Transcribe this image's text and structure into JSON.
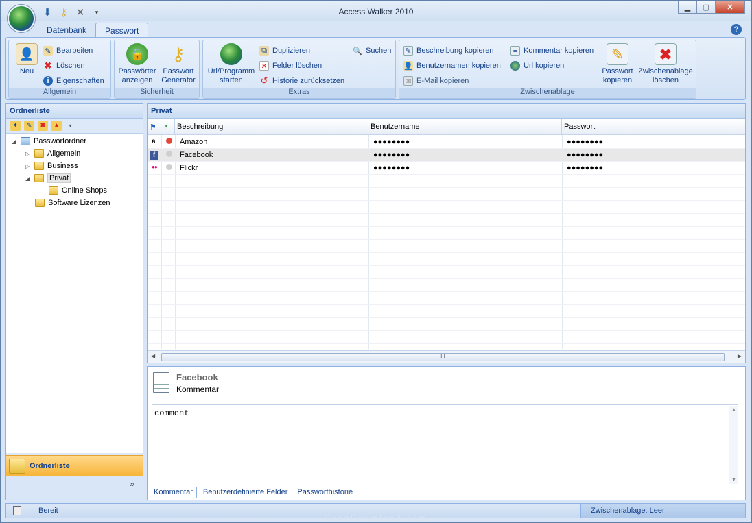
{
  "window": {
    "title": "Access Walker 2010"
  },
  "ribbon_tabs": [
    {
      "label": "Datenbank"
    },
    {
      "label": "Passwort"
    }
  ],
  "ribbon": {
    "allgemein": {
      "label": "Allgemein",
      "neu": "Neu",
      "bearbeiten": "Bearbeiten",
      "loeschen": "Löschen",
      "eigenschaften": "Eigenschaften"
    },
    "sicherheit": {
      "label": "Sicherheit",
      "anzeigen": [
        "Passwörter",
        "anzeigen"
      ],
      "generator": [
        "Passwort",
        "Generator"
      ]
    },
    "extras": {
      "label": "Extras",
      "url": [
        "Url/Programm",
        "starten"
      ],
      "duplizieren": "Duplizieren",
      "felder": "Felder löschen",
      "historie": "Historie zurücksetzen",
      "suchen": "Suchen"
    },
    "zwischenablage": {
      "label": "Zwischenablage",
      "beschreibung": "Beschreibung kopieren",
      "benutzer": "Benutzernamen kopieren",
      "email": "E-Mail kopieren",
      "kommentar": "Kommentar kopieren",
      "url": "Url kopieren",
      "pw_kopieren": [
        "Passwort",
        "kopieren"
      ],
      "clear": [
        "Zwischenablage",
        "löschen"
      ]
    }
  },
  "folder_panel": {
    "title": "Ordnerliste",
    "tree": [
      {
        "label": "Passwortordner"
      },
      {
        "label": "Allgemein"
      },
      {
        "label": "Business"
      },
      {
        "label": "Privat"
      },
      {
        "label": "Online Shops"
      },
      {
        "label": "Software Lizenzen"
      }
    ],
    "bottom_button": "Ordnerliste",
    "chevron": "»"
  },
  "list_panel": {
    "title": "Privat",
    "columns": [
      "Beschreibung",
      "Benutzername",
      "Passwort"
    ],
    "rows": [
      {
        "icon": "a",
        "status": "#e2483a",
        "beschreibung": "Amazon",
        "benutzer": "●●●●●●●●",
        "passwort": "●●●●●●●●"
      },
      {
        "icon": "f",
        "status": "#cfcfcf",
        "beschreibung": "Facebook",
        "benutzer": "●●●●●●●●",
        "passwort": "●●●●●●●●"
      },
      {
        "icon": "●●",
        "status": "#cfcfcf",
        "beschreibung": "Flickr",
        "benutzer": "●●●●●●●●",
        "passwort": "●●●●●●●●"
      }
    ],
    "scroll_grip": "III"
  },
  "detail": {
    "title": "Facebook",
    "subtitle": "Kommentar",
    "text": "comment",
    "tabs": [
      "Kommentar",
      "Benutzerdefinierte Felder",
      "Passworthistorie"
    ]
  },
  "statusbar": {
    "left": "Bereit",
    "right": "Zwischenablage: Leer"
  },
  "watermark": "GearDownload.com"
}
